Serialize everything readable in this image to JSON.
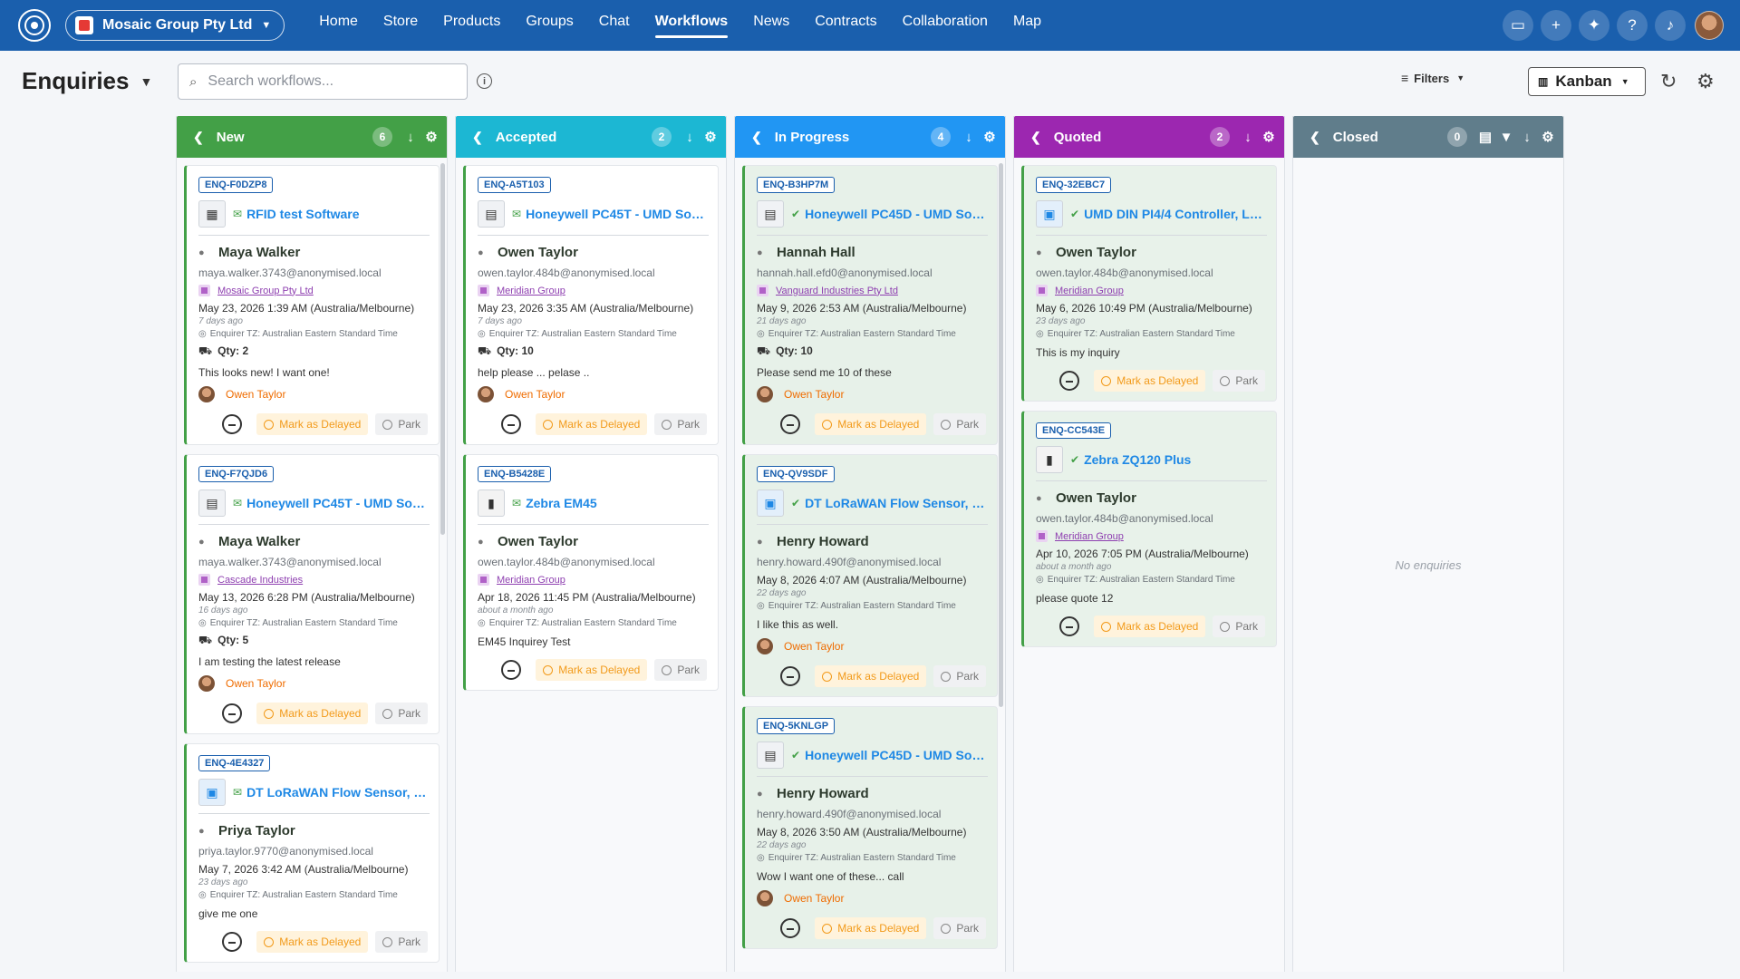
{
  "org": {
    "name": "Mosaic Group Pty Ltd"
  },
  "nav": {
    "items": [
      "Home",
      "Store",
      "Products",
      "Groups",
      "Chat",
      "Workflows",
      "News",
      "Contracts",
      "Collaboration",
      "Map"
    ],
    "active": "Workflows"
  },
  "page": {
    "title": "Enquiries",
    "search_placeholder": "Search workflows...",
    "filters_label": "Filters",
    "view_label": "Kanban",
    "empty_text": "No enquiries"
  },
  "labels": {
    "mark_delayed": "Mark as Delayed",
    "park": "Park",
    "tz": "Enquirer TZ: Australian Eastern Standard Time",
    "qty_prefix": "Qty: "
  },
  "colors": {
    "nav": "#1a5fad",
    "new": "#43a047",
    "accepted": "#1cb7d3",
    "in_progress": "#2196f3",
    "quoted": "#9c27b0",
    "closed": "#607d8b"
  },
  "columns": [
    {
      "title": "New",
      "count": "6",
      "cards": [
        {
          "id": "ENQ-F0DZP8",
          "product": "RFID test Software",
          "name": "Maya Walker",
          "email": "maya.walker.3743@anonymised.local",
          "company": "Mosaic Group Pty Ltd",
          "date": "May 23, 2026 1:39 AM (Australia/Melbourne)",
          "ago": "7 days ago",
          "qty": "2",
          "message": "This looks new! I want one!",
          "assignee": "Owen Taylor"
        },
        {
          "id": "ENQ-F7QJD6",
          "product": "Honeywell PC45T - UMD Soluti...",
          "name": "Maya Walker",
          "email": "maya.walker.3743@anonymised.local",
          "company": "Cascade Industries",
          "date": "May 13, 2026 6:28 PM (Australia/Melbourne)",
          "ago": "16 days ago",
          "qty": "5",
          "message": "I am testing the latest release",
          "assignee": "Owen Taylor"
        },
        {
          "id": "ENQ-4E4327",
          "product": "DT LoRaWAN Flow Sensor, G1\"/...",
          "name": "Priya Taylor",
          "email": "priya.taylor.9770@anonymised.local",
          "date": "May 7, 2026 3:42 AM (Australia/Melbourne)",
          "ago": "23 days ago",
          "message": "give me one"
        }
      ]
    },
    {
      "title": "Accepted",
      "count": "2",
      "cards": [
        {
          "id": "ENQ-A5T103",
          "product": "Honeywell PC45T - UMD Soluti...",
          "name": "Owen Taylor",
          "email": "owen.taylor.484b@anonymised.local",
          "company": "Meridian Group",
          "date": "May 23, 2026 3:35 AM (Australia/Melbourne)",
          "ago": "7 days ago",
          "qty": "10",
          "message": "help please ... pelase ..",
          "assignee": "Owen Taylor"
        },
        {
          "id": "ENQ-B5428E",
          "product": "Zebra EM45",
          "name": "Owen Taylor",
          "email": "owen.taylor.484b@anonymised.local",
          "company": "Meridian Group",
          "date": "Apr 18, 2026 11:45 PM (Australia/Melbourne)",
          "ago": "about a month ago",
          "message": "EM45 Inquirey Test"
        }
      ]
    },
    {
      "title": "In Progress",
      "count": "4",
      "cards": [
        {
          "id": "ENQ-B3HP7M",
          "product": "Honeywell PC45D - UMD Soluti...",
          "name": "Hannah Hall",
          "email": "hannah.hall.efd0@anonymised.local",
          "company": "Vanguard Industries Pty Ltd",
          "date": "May 9, 2026 2:53 AM (Australia/Melbourne)",
          "ago": "21 days ago",
          "qty": "10",
          "message": "Please send me 10 of these",
          "assignee": "Owen Taylor"
        },
        {
          "id": "ENQ-QV9SDF",
          "product": "DT LoRaWAN Flow Sensor, G1/...",
          "name": "Henry Howard",
          "email": "henry.howard.490f@anonymised.local",
          "date": "May 8, 2026 4:07 AM (Australia/Melbourne)",
          "ago": "22 days ago",
          "message": "I like this as well.",
          "assignee": "Owen Taylor"
        },
        {
          "id": "ENQ-5KNLGP",
          "product": "Honeywell PC45D - UMD Soluti...",
          "name": "Henry Howard",
          "email": "henry.howard.490f@anonymised.local",
          "date": "May 8, 2026 3:50 AM (Australia/Melbourne)",
          "ago": "22 days ago",
          "message": "Wow I want one of these... call",
          "assignee": "Owen Taylor"
        }
      ]
    },
    {
      "title": "Quoted",
      "count": "2",
      "cards": [
        {
          "id": "ENQ-32EBC7",
          "product": "UMD DIN PI4/4 Controller, Lin...",
          "name": "Owen Taylor",
          "email": "owen.taylor.484b@anonymised.local",
          "company": "Meridian Group",
          "date": "May 6, 2026 10:49 PM (Australia/Melbourne)",
          "ago": "23 days ago",
          "message": "This is my inquiry"
        },
        {
          "id": "ENQ-CC543E",
          "product": "Zebra ZQ120 Plus",
          "name": "Owen Taylor",
          "email": "owen.taylor.484b@anonymised.local",
          "company": "Meridian Group",
          "date": "Apr 10, 2026 7:05 PM (Australia/Melbourne)",
          "ago": "about a month ago",
          "message": "please quote 12"
        }
      ]
    },
    {
      "title": "Closed",
      "count": "0",
      "cards": []
    }
  ]
}
